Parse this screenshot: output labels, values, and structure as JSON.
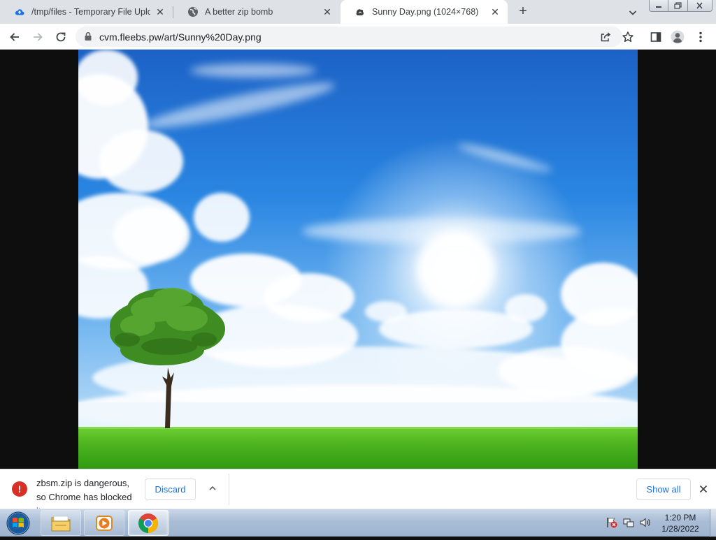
{
  "browser": {
    "tabs": [
      {
        "title": "/tmp/files - Temporary File Uploa",
        "icon": "cloud-upload-icon",
        "close_label": "✕"
      },
      {
        "title": "A better zip bomb",
        "icon": "globe-icon",
        "close_label": "✕"
      },
      {
        "title": "Sunny Day.png (1024×768)",
        "icon": "image-file-icon",
        "close_label": "✕"
      }
    ],
    "new_tab_label": "+",
    "address_bar": {
      "url": "cvm.fleebs.pw/art/Sunny%20Day.png"
    }
  },
  "download_bar": {
    "item": {
      "message": "zbsm.zip is dangerous, so Chrome has blocked it.",
      "warning_symbol": "!",
      "discard_label": "Discard"
    },
    "show_all_label": "Show all"
  },
  "taskbar": {
    "clock": {
      "time": "1:20 PM",
      "date": "1/28/2022"
    },
    "apps": [
      {
        "name": "Windows Explorer",
        "icon": "folder-icon"
      },
      {
        "name": "Windows Media Player",
        "icon": "media-player-icon"
      },
      {
        "name": "Google Chrome",
        "icon": "chrome-icon"
      }
    ]
  },
  "colors": {
    "accent_blue": "#1a73e8",
    "danger_red": "#d93025",
    "tab_strip": "#dee1e6",
    "sky_top": "#1f6fd0",
    "grass": "#4eb520"
  }
}
